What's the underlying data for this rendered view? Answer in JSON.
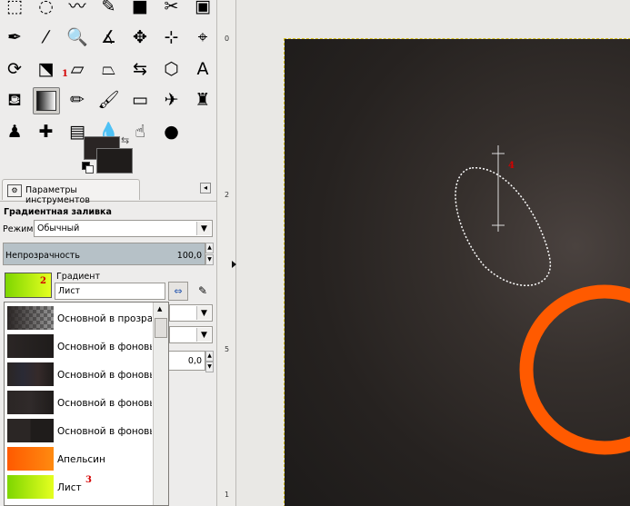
{
  "toolbox": {
    "tools": [
      {
        "name": "rect-select-icon",
        "glyph": "⬚"
      },
      {
        "name": "ellipse-select-icon",
        "glyph": "◌"
      },
      {
        "name": "free-select-icon",
        "glyph": "〰"
      },
      {
        "name": "fuzzy-select-icon",
        "glyph": "✎"
      },
      {
        "name": "color-select-icon",
        "glyph": "■"
      },
      {
        "name": "scissors-icon",
        "glyph": "✂"
      },
      {
        "name": "foreground-select-icon",
        "glyph": "▣"
      },
      {
        "name": "paths-icon",
        "glyph": "✒"
      },
      {
        "name": "color-picker-icon",
        "glyph": "⁄"
      },
      {
        "name": "zoom-icon",
        "glyph": "🔍"
      },
      {
        "name": "measure-icon",
        "glyph": "∡"
      },
      {
        "name": "move-icon",
        "glyph": "✥"
      },
      {
        "name": "align-icon",
        "glyph": "⊹"
      },
      {
        "name": "crop-icon",
        "glyph": "⌖"
      },
      {
        "name": "rotate-icon",
        "glyph": "⟳"
      },
      {
        "name": "scale-icon",
        "glyph": "⬔"
      },
      {
        "name": "shear-icon",
        "glyph": "▱"
      },
      {
        "name": "perspective-icon",
        "glyph": "⏢"
      },
      {
        "name": "flip-icon",
        "glyph": "⇆"
      },
      {
        "name": "cage-transform-icon",
        "glyph": "⬡"
      },
      {
        "name": "text-icon",
        "glyph": "A"
      },
      {
        "name": "bucket-fill-icon",
        "glyph": "⛾"
      },
      {
        "name": "blend-icon",
        "glyph": ""
      },
      {
        "name": "pencil-icon",
        "glyph": "✏"
      },
      {
        "name": "paintbrush-icon",
        "glyph": "🖌"
      },
      {
        "name": "eraser-icon",
        "glyph": "▭"
      },
      {
        "name": "airbrush-icon",
        "glyph": "✈"
      },
      {
        "name": "ink-icon",
        "glyph": "♜"
      },
      {
        "name": "clone-icon",
        "glyph": "♟"
      },
      {
        "name": "heal-icon",
        "glyph": "✚"
      },
      {
        "name": "perspective-clone-icon",
        "glyph": "▤"
      },
      {
        "name": "blur-sharpen-icon",
        "glyph": "💧"
      },
      {
        "name": "smudge-icon",
        "glyph": "☝"
      },
      {
        "name": "dodge-burn-icon",
        "glyph": "●"
      }
    ],
    "marker_1": "1"
  },
  "colors": {
    "foreground": "#2a2524",
    "background": "#1f1c1b"
  },
  "dock": {
    "tab_label": "Параметры инструментов"
  },
  "tool_options": {
    "title": "Градиентная заливка",
    "mode_label": "Режим:",
    "mode_value": "Обычный",
    "opacity_label": "Непрозрачность",
    "opacity_value": "100,0",
    "opacity_fraction": 1.0,
    "gradient_label": "Градиент",
    "gradient_value": "Лист",
    "marker_2": "2",
    "offset_value": "0,0"
  },
  "gradient_list": [
    {
      "label": "Основной в прозрачный",
      "swatch": "checker"
    },
    {
      "label": "Основной в фоновый (Жёсткий край)",
      "swatch": "linear-gradient(to right,#2b2625,#1f1c1b)"
    },
    {
      "label": "Основной в фоновый (HSV против часовой)",
      "swatch": "linear-gradient(to right,#2b2625,#2a2a35,#352a2a,#1f1c1b)"
    },
    {
      "label": "Основной в фоновый (HSV по часовой)",
      "swatch": "linear-gradient(to right,#2b2625,#302a2a,#1f1c1b)"
    },
    {
      "label": "Основной в фоновый (RGB)",
      "swatch": "linear-gradient(to right,#2b2625 0%,#2b2625 50%,#1f1c1b 50%,#1f1c1b 100%)"
    },
    {
      "label": "Апельсин",
      "swatch": "linear-gradient(to right,#ff5a00,#ff8a10)"
    },
    {
      "label": "Лист",
      "swatch": "linear-gradient(to right,#7ed600,#e5ff20)"
    }
  ],
  "gradient_list_marker_3": "3",
  "ruler_ticks": [
    "0",
    "2",
    "5",
    "1"
  ],
  "canvas": {
    "marker_4": "4",
    "ring_color": "#ff5a00"
  }
}
